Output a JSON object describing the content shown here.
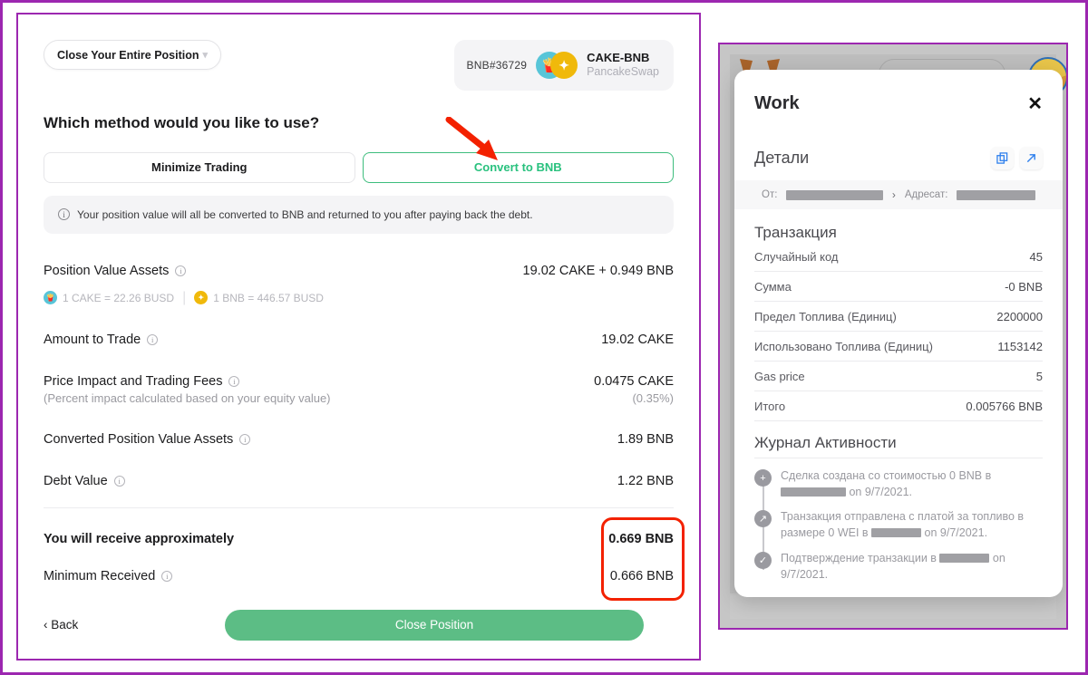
{
  "left_panel": {
    "position_dropdown": {
      "label": "Close Your Entire Position",
      "chevron": "chevron-down-icon"
    },
    "pair_badge": {
      "position_id": "BNB#36729",
      "pair_name": "CAKE-BNB",
      "exchange": "PancakeSwap",
      "cake_icon": "pancake-icon",
      "bnb_icon": "bnb-icon"
    },
    "question": "Which method would you like to use?",
    "tabs": [
      {
        "label": "Minimize Trading",
        "active": false
      },
      {
        "label": "Convert to BNB",
        "active": true
      }
    ],
    "info_notice": "Your position value will all be converted to BNB and returned to you after paying back the debt.",
    "rows": [
      {
        "label": "Position Value Assets",
        "value": "19.02 CAKE + 0.949 BNB",
        "has_info": true
      },
      {
        "label": "Amount to Trade",
        "value": "19.02 CAKE",
        "has_info": true
      },
      {
        "label": "Price Impact and Trading Fees",
        "value": "0.0475 CAKE",
        "has_info": true,
        "sub_label": "(Percent impact calculated based on your equity value)",
        "sub_value": "(0.35%)"
      },
      {
        "label": "Converted Position Value Assets",
        "value": "1.89 BNB",
        "has_info": true
      },
      {
        "label": "Debt Value",
        "value": "1.22 BNB",
        "has_info": true
      }
    ],
    "rates": [
      {
        "text": "1 CAKE = 22.26 BUSD",
        "icon": "cake-icon"
      },
      {
        "text": "1 BNB = 446.57 BUSD",
        "icon": "bnb-icon"
      }
    ],
    "receive": {
      "label": "You will receive approximately",
      "value": "0.669 BNB",
      "minimum_label": "Minimum Received",
      "minimum_value": "0.666 BNB"
    },
    "footer": {
      "back_label": "‹ Back",
      "close_label": "Close Position"
    },
    "annotations": {
      "arrow_color": "#f32100",
      "highlight_color": "#f32100"
    }
  },
  "right_panel": {
    "modal": {
      "title": "Work",
      "close_icon": "close-icon",
      "details_title": "Детали",
      "copy_icon": "copy-icon",
      "external_link_icon": "external-link-icon",
      "address_row": {
        "from_label": "От:",
        "to_label": "Адресат:",
        "separator": "›"
      },
      "transaction_title": "Транзакция",
      "transaction_rows": [
        {
          "key": "Случайный код",
          "value": "45"
        },
        {
          "key": "Сумма",
          "value": "-0 BNB"
        },
        {
          "key": "Предел Топлива (Единиц)",
          "value": "2200000"
        },
        {
          "key": "Использовано Топлива (Единиц)",
          "value": "1153142"
        },
        {
          "key": "Gas price",
          "value": "5"
        },
        {
          "key": "Итого",
          "value": "0.005766 BNB"
        }
      ],
      "activity_title": "Журнал Активности",
      "activity_log": [
        {
          "icon": "plus-icon",
          "text_before": "Сделка создана со стоимостью 0 BNB в",
          "text_after": "on 9/7/2021."
        },
        {
          "icon": "arrow-up-right-icon",
          "text_before": "Транзакция отправлена с платой за топливо в размере 0 WEI в",
          "text_after": "on 9/7/2021."
        },
        {
          "icon": "check-icon",
          "text_before": "Подтверждение транзакции в",
          "text_after": "on 9/7/2021."
        }
      ]
    },
    "background": {
      "fox_icon": "fox-logo-icon",
      "search_bar": "search-bar",
      "avatar": "avatar"
    }
  }
}
